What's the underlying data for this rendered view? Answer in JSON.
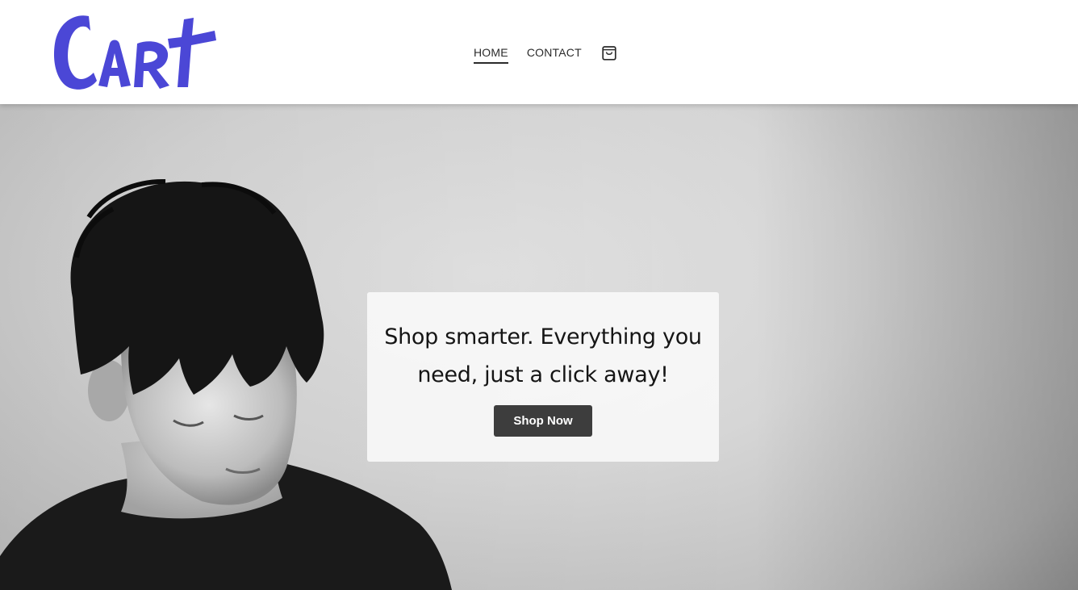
{
  "header": {
    "logo_text": "CaRt",
    "nav": {
      "home_label": "HOME",
      "contact_label": "CONTACT"
    },
    "cart_icon": "shopping-bag-icon"
  },
  "hero": {
    "heading": "Shop smarter. Everything you need, just a click away!",
    "button_label": "Shop Now",
    "image": "black-and-white-portrait-young-man-looking-down"
  },
  "colors": {
    "logo": "#4b47d6",
    "button_bg": "#3d3d3d",
    "text": "#151515"
  }
}
